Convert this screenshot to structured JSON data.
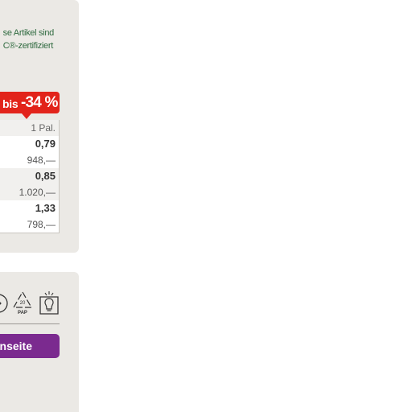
{
  "fsc_note": {
    "line1": "se Artikel sind",
    "line2": "C®-zertifiziert"
  },
  "discount_badge": {
    "prefix": "bis",
    "value": "-34 %",
    "color": "#e2231a"
  },
  "price_table": {
    "unit_header": "1 Pal.",
    "rows": [
      {
        "price": "0,79",
        "total": "948,—"
      },
      {
        "price": "0,85",
        "total": "1.020,—"
      },
      {
        "price": "1,33",
        "total": "798,—"
      }
    ]
  },
  "icons": {
    "recycle_code_number": "20",
    "recycle_code_label": "PAP",
    "list": [
      "circle-symbol-icon",
      "recycling-pap-icon",
      "lightbulb-box-icon"
    ]
  },
  "nav_button": {
    "label": "nseite",
    "color": "#7b2a8f"
  }
}
